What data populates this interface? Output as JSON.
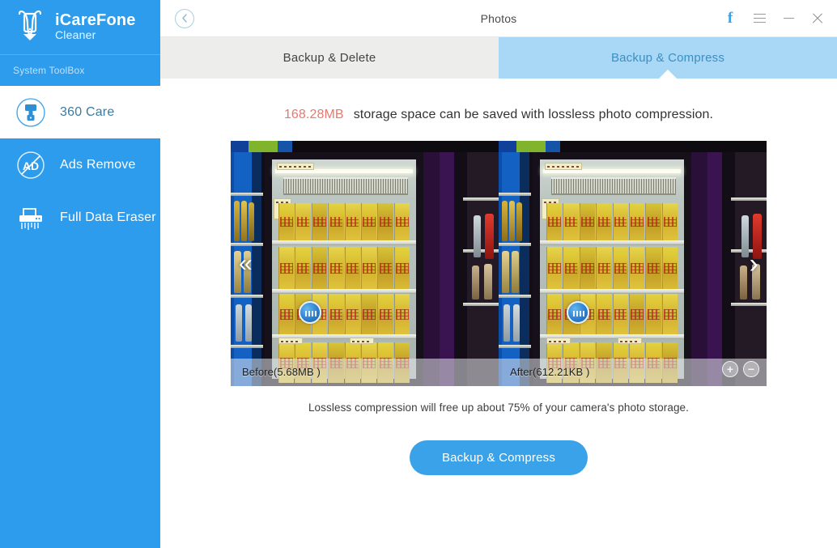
{
  "sidebar": {
    "brand": {
      "name": "iCareFone",
      "sub": "Cleaner",
      "logo_icon": "phone-pin-icon"
    },
    "section_label": "System ToolBox",
    "items": [
      {
        "label": "360 Care",
        "icon": "brush-circle-icon",
        "active": true
      },
      {
        "label": "Ads Remove",
        "icon": "ad-blocked-circle-icon",
        "active": false
      },
      {
        "label": "Full Data Eraser",
        "icon": "shredder-icon",
        "active": false
      }
    ]
  },
  "titlebar": {
    "back_icon": "back-chevron-circle-icon",
    "title": "Photos",
    "facebook_icon": "facebook-icon",
    "menu_icon": "hamburger-menu-icon",
    "minimize_icon": "minimize-icon",
    "close_icon": "close-icon"
  },
  "tabs": [
    {
      "label": "Backup & Delete",
      "active": false
    },
    {
      "label": "Backup & Compress",
      "active": true
    }
  ],
  "headline": {
    "amount": "168.28MB",
    "text": "storage space can be saved with lossless photo compression."
  },
  "compare": {
    "before_caption": "Before(5.68MB )",
    "after_caption": "After(612.21KB )",
    "prev_icon": "chevron-left-icon",
    "next_icon": "chevron-right-icon",
    "zoom_in_icon": "zoom-in-icon",
    "zoom_out_icon": "zoom-out-icon",
    "zoom_in_label": "+",
    "zoom_out_label": "−"
  },
  "subnote": "Lossless compression will free up about 75% of your camera's photo storage.",
  "cta": {
    "label": "Backup & Compress"
  },
  "colors": {
    "sidebar_blue": "#2d9cec",
    "accent_blue": "#3aa2e8",
    "active_tab_blue": "#a9d8f7",
    "inactive_tab_grey": "#ededeb",
    "amount_red": "#e9786f",
    "sidebar_label_blue": "#bfe2fb"
  }
}
